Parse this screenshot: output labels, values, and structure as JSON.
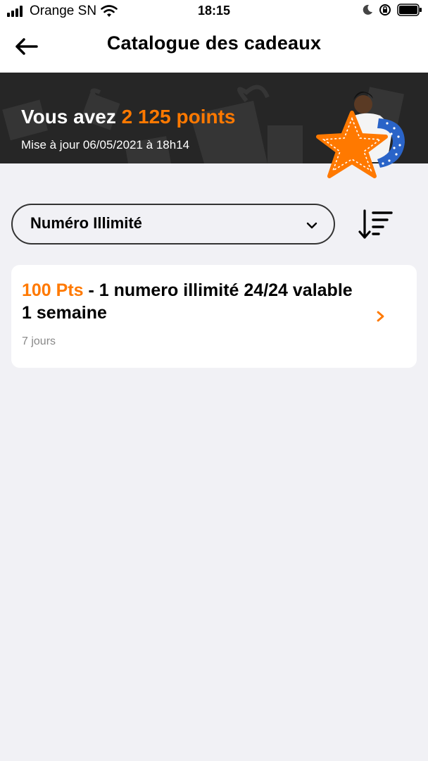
{
  "status_bar": {
    "carrier": "Orange SN",
    "time": "18:15",
    "icons": [
      "signal-icon",
      "wifi-icon",
      "moon-icon",
      "rotation-lock-icon",
      "battery-icon"
    ]
  },
  "navbar": {
    "back_icon": "arrow-left-icon",
    "title": "Catalogue des cadeaux"
  },
  "banner": {
    "title_prefix": "Vous avez ",
    "points": "2 125 points",
    "updated": "Mise à jour 06/05/2021 à 18h14",
    "accent_color": "#ff7900"
  },
  "filter": {
    "selected": "Numéro Illimité",
    "chevron_icon": "chevron-down-icon",
    "sort_icon": "sort-descending-icon"
  },
  "offers": [
    {
      "points": "100 Pts",
      "title": " - 1 numero illimité 24/24 valable 1 semaine",
      "duration": "7 jours",
      "chevron_icon": "chevron-right-icon"
    }
  ]
}
